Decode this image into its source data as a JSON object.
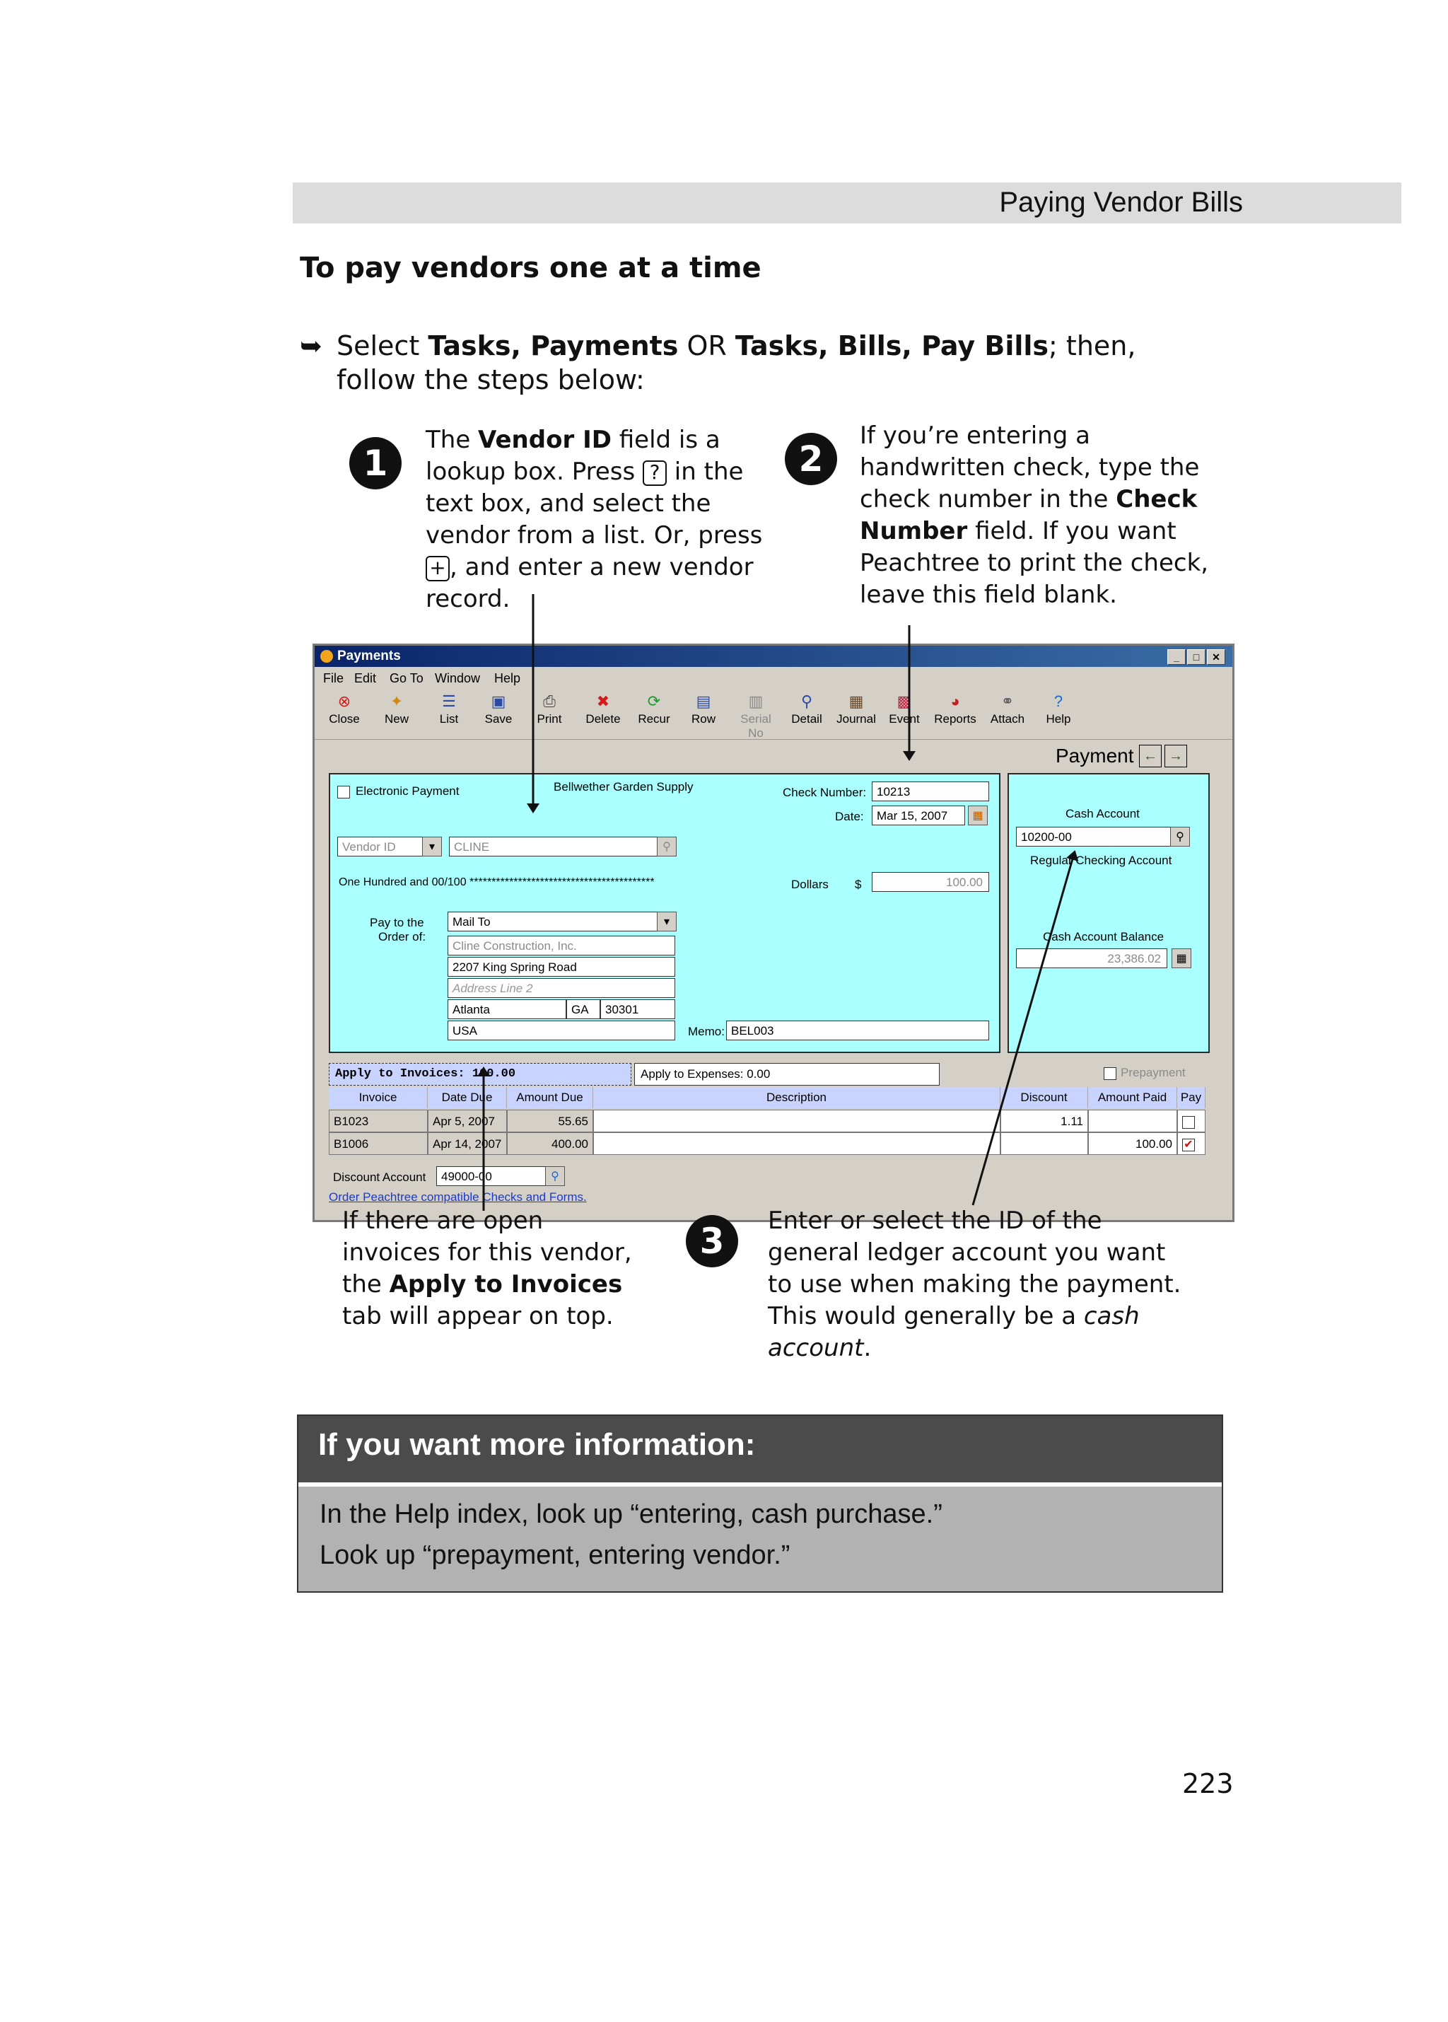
{
  "header": {
    "running_title": "Paying Vendor Bills"
  },
  "section": {
    "title": "To pay vendors one at a time"
  },
  "instruction": {
    "bullet": "➥",
    "p1": "Select ",
    "b1": "Tasks, Payments",
    "p2": " OR ",
    "b2": "Tasks, Bills, Pay Bills",
    "p3": "; then, follow the steps below:"
  },
  "callouts": {
    "step1": {
      "num": "1",
      "t1": "The ",
      "b1": "Vendor ID",
      "t2": " field is a lookup box. Press ",
      "key1": "?",
      "t3": " in the text box, and select the vendor from a list. Or, press ",
      "key2": "+",
      "t4": ", and enter a new vendor record."
    },
    "step2": {
      "num": "2",
      "t1": "If you’re entering a handwritten check, type the check number in the ",
      "b1": "Check Number",
      "t2": " field. If you want Peachtree to print the check, leave this field blank."
    },
    "step3": {
      "num": "3",
      "t1": "Enter or select the ID of the general ledger account you want to use when making the payment. This would generally be a ",
      "i1": "cash account",
      "t2": "."
    },
    "note_left": {
      "t1": "If there are open invoices for this vendor, the ",
      "b1": "Apply to Invoices",
      "t2": " tab will appear on top."
    }
  },
  "window": {
    "title": "Payments",
    "menu": [
      "File",
      "Edit",
      "Go To",
      "Window",
      "Help"
    ],
    "toolbar": [
      "Close",
      "New",
      "List",
      "Save",
      "Print",
      "Delete",
      "Recur",
      "Row",
      "Serial No",
      "Detail",
      "Journal",
      "Event",
      "Reports",
      "Attach",
      "Help"
    ],
    "form_title": "Payment",
    "electronic_payment": "Electronic Payment",
    "company": "Bellwether Garden Supply",
    "check_number_label": "Check Number:",
    "check_number": "10213",
    "date_label": "Date:",
    "date": "Mar 15, 2007",
    "vendor_id_label": "Vendor ID",
    "vendor_id": "CLINE",
    "amount_words": "One Hundred and 00/100 ******************************************",
    "dollars_label": "Dollars",
    "currency": "$",
    "amount": "100.00",
    "pay_to_label_1": "Pay to the",
    "pay_to_label_2": "Order of:",
    "mail_to": "Mail To",
    "address": {
      "name": "Cline Construction, Inc.",
      "line1": "2207 King Spring Road",
      "line2_placeholder": "Address Line 2",
      "city": "Atlanta",
      "state": "GA",
      "zip": "30301",
      "country": "USA"
    },
    "memo_label": "Memo:",
    "memo": "BEL003",
    "cash_account_label": "Cash Account",
    "cash_account": "10200-00",
    "cash_account_name": "Regular Checking Account",
    "cash_balance_label": "Cash Account Balance",
    "cash_balance": "23,386.02",
    "tab_invoices": "Apply to Invoices: 100.00",
    "tab_expenses": "Apply to Expenses: 0.00",
    "prepayment": "Prepayment",
    "columns": [
      "Invoice",
      "Date Due",
      "Amount Due",
      "Description",
      "Discount",
      "Amount Paid",
      "Pay"
    ],
    "rows": [
      {
        "invoice": "B1023",
        "date": "Apr 5, 2007",
        "amount_due": "55.65",
        "description": "",
        "discount": "1.11",
        "amount_paid": "",
        "pay": ""
      },
      {
        "invoice": "B1006",
        "date": "Apr 14, 2007",
        "amount_due": "400.00",
        "description": "",
        "discount": "",
        "amount_paid": "100.00",
        "pay": "✔"
      }
    ],
    "discount_account_label": "Discount Account",
    "discount_account": "49000-00",
    "order_link": "Order Peachtree compatible Checks and Forms."
  },
  "info": {
    "heading": "If you want more information:",
    "line1": "In the Help index, look up “entering, cash purchase.”",
    "line2": "Look up “prepayment, entering vendor.”"
  },
  "page_number": "223"
}
